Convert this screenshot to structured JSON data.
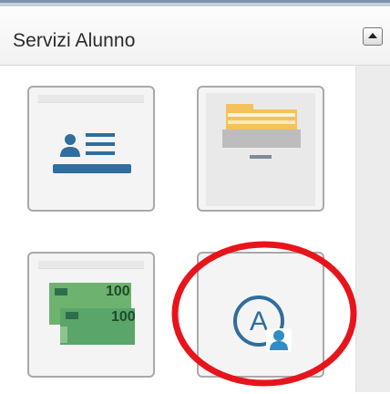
{
  "panel": {
    "title": "Servizi Alunno",
    "collapse_icon": "collapse-up-icon"
  },
  "tiles": [
    {
      "name": "student-id-card-tile",
      "icon": "id-card-icon"
    },
    {
      "name": "archive-drawer-tile",
      "icon": "folder-drawer-icon"
    },
    {
      "name": "payments-tile",
      "icon": "banknotes-icon",
      "note_value_back": "100",
      "note_value_front": "100"
    },
    {
      "name": "student-account-tile",
      "icon": "account-user-icon",
      "letter": "A"
    }
  ],
  "colors": {
    "brand_blue": "#2f6e9e",
    "folder_yellow": "#f5c15c",
    "note_green": "#5aa56a",
    "annotation_red": "#e8141c"
  }
}
